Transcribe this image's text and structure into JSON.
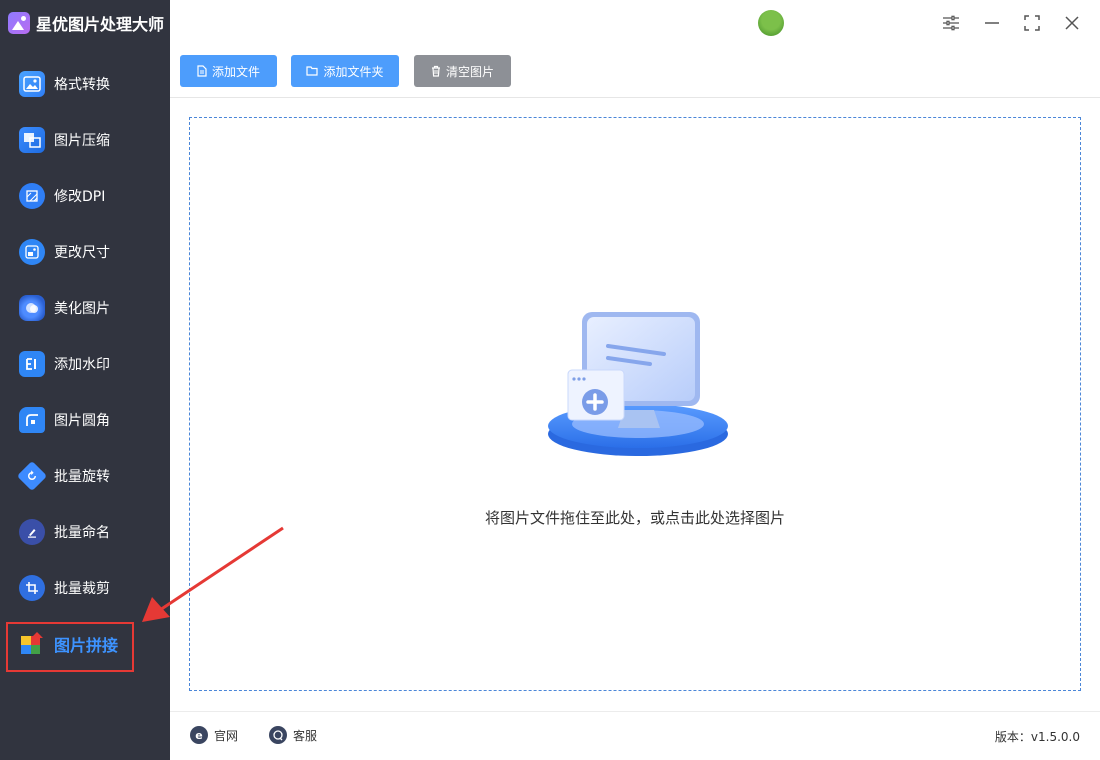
{
  "app": {
    "name": "星优图片处理大师"
  },
  "sidebar": {
    "items": [
      {
        "label": "格式转换",
        "icon": "image-convert-icon"
      },
      {
        "label": "图片压缩",
        "icon": "image-compress-icon"
      },
      {
        "label": "修改DPI",
        "icon": "dpi-icon"
      },
      {
        "label": "更改尺寸",
        "icon": "resize-icon"
      },
      {
        "label": "美化图片",
        "icon": "beautify-icon"
      },
      {
        "label": "添加水印",
        "icon": "watermark-icon"
      },
      {
        "label": "图片圆角",
        "icon": "round-corner-icon"
      },
      {
        "label": "批量旋转",
        "icon": "rotate-icon"
      },
      {
        "label": "批量命名",
        "icon": "rename-icon"
      },
      {
        "label": "批量裁剪",
        "icon": "crop-icon"
      },
      {
        "label": "图片拼接",
        "icon": "stitch-icon",
        "active": true
      }
    ]
  },
  "toolbar": {
    "add_file": "添加文件",
    "add_folder": "添加文件夹",
    "clear_images": "清空图片"
  },
  "dropzone": {
    "hint": "将图片文件拖住至此处，或点击此处选择图片"
  },
  "footer": {
    "website": "官网",
    "support": "客服",
    "version": "版本：v1.5.0.0"
  },
  "colors": {
    "sidebar_bg": "#31343f",
    "accent": "#4d9dfc",
    "active_label": "#3d93ff",
    "clear_button": "#8d9096",
    "annotation": "#e53935"
  }
}
